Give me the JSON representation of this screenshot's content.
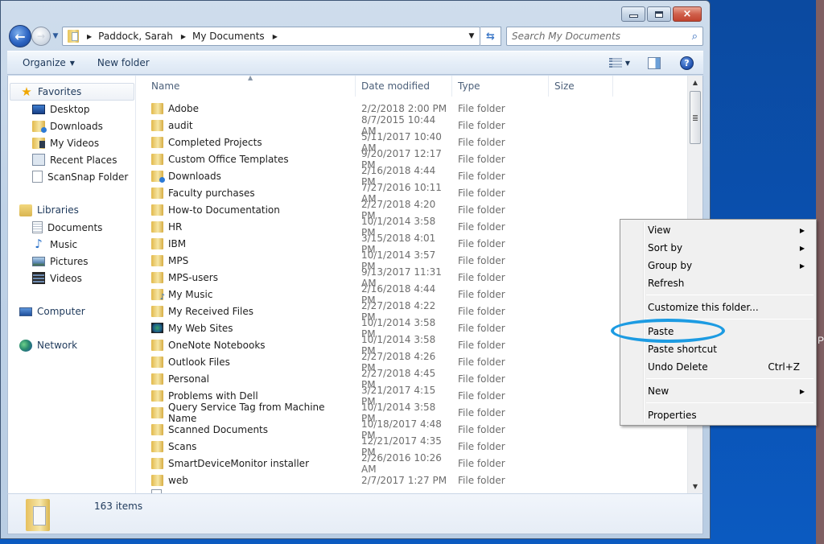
{
  "window": {
    "controls": {
      "minimize": "minimize",
      "maximize": "maximize",
      "close": "×"
    }
  },
  "address_bar": {
    "breadcrumbs": [
      "Paddock, Sarah",
      "My Documents"
    ],
    "back_icon": "arrow-left",
    "forward_icon": "arrow-right",
    "refresh_icon": "⇆"
  },
  "search": {
    "placeholder": "Search My Documents",
    "icon": "⌕"
  },
  "toolbar": {
    "organize_label": "Organize",
    "new_folder_label": "New folder",
    "help_label": "?"
  },
  "nav_pane": {
    "favorites": {
      "label": "Favorites",
      "items": [
        {
          "label": "Desktop",
          "icon": "desktop-icon"
        },
        {
          "label": "Downloads",
          "icon": "downloads-folder-icon"
        },
        {
          "label": "My Videos",
          "icon": "videos-folder-icon"
        },
        {
          "label": "Recent Places",
          "icon": "recent-places-icon"
        },
        {
          "label": "ScanSnap Folder",
          "icon": "page-icon"
        }
      ]
    },
    "libraries": {
      "label": "Libraries",
      "items": [
        {
          "label": "Documents",
          "icon": "documents-icon"
        },
        {
          "label": "Music",
          "icon": "music-icon"
        },
        {
          "label": "Pictures",
          "icon": "pictures-icon"
        },
        {
          "label": "Videos",
          "icon": "videos-icon"
        }
      ]
    },
    "computer": {
      "label": "Computer"
    },
    "network": {
      "label": "Network"
    }
  },
  "file_list": {
    "columns": [
      "Name",
      "Date modified",
      "Type",
      "Size"
    ],
    "sort_column": "Name",
    "rows": [
      {
        "name": "Adobe",
        "date": "2/2/2018 2:00 PM",
        "type": "File folder",
        "icon": "folder"
      },
      {
        "name": "audit",
        "date": "8/7/2015 10:44 AM",
        "type": "File folder",
        "icon": "folder"
      },
      {
        "name": "Completed Projects",
        "date": "5/11/2017 10:40 AM",
        "type": "File folder",
        "icon": "folder"
      },
      {
        "name": "Custom Office Templates",
        "date": "9/20/2017 12:17 PM",
        "type": "File folder",
        "icon": "folder"
      },
      {
        "name": "Downloads",
        "date": "2/16/2018 4:44 PM",
        "type": "File folder",
        "icon": "downloads-folder"
      },
      {
        "name": "Faculty purchases",
        "date": "7/27/2016 10:11 AM",
        "type": "File folder",
        "icon": "folder"
      },
      {
        "name": "How-to Documentation",
        "date": "2/27/2018 4:20 PM",
        "type": "File folder",
        "icon": "folder"
      },
      {
        "name": "HR",
        "date": "10/1/2014 3:58 PM",
        "type": "File folder",
        "icon": "folder"
      },
      {
        "name": "IBM",
        "date": "3/15/2018 4:01 PM",
        "type": "File folder",
        "icon": "folder"
      },
      {
        "name": "MPS",
        "date": "10/1/2014 3:57 PM",
        "type": "File folder",
        "icon": "folder"
      },
      {
        "name": "MPS-users",
        "date": "9/13/2017 11:31 AM",
        "type": "File folder",
        "icon": "folder"
      },
      {
        "name": "My Music",
        "date": "2/16/2018 4:44 PM",
        "type": "File folder",
        "icon": "music-folder"
      },
      {
        "name": "My Received Files",
        "date": "2/27/2018 4:22 PM",
        "type": "File folder",
        "icon": "folder"
      },
      {
        "name": "My Web Sites",
        "date": "10/1/2014 3:58 PM",
        "type": "File folder",
        "icon": "web-sites"
      },
      {
        "name": "OneNote Notebooks",
        "date": "10/1/2014 3:58 PM",
        "type": "File folder",
        "icon": "folder"
      },
      {
        "name": "Outlook Files",
        "date": "2/27/2018 4:26 PM",
        "type": "File folder",
        "icon": "folder"
      },
      {
        "name": "Personal",
        "date": "2/27/2018 4:45 PM",
        "type": "File folder",
        "icon": "folder"
      },
      {
        "name": "Problems with Dell",
        "date": "3/21/2017 4:15 PM",
        "type": "File folder",
        "icon": "folder"
      },
      {
        "name": "Query Service Tag from Machine Name",
        "date": "10/1/2014 3:58 PM",
        "type": "File folder",
        "icon": "folder"
      },
      {
        "name": "Scanned Documents",
        "date": "10/18/2017 4:48 PM",
        "type": "File folder",
        "icon": "folder"
      },
      {
        "name": "Scans",
        "date": "12/21/2017 4:35 PM",
        "type": "File folder",
        "icon": "folder"
      },
      {
        "name": "SmartDeviceMonitor installer",
        "date": "2/26/2016 10:26 AM",
        "type": "File folder",
        "icon": "folder"
      },
      {
        "name": "web",
        "date": "2/7/2017 1:27 PM",
        "type": "File folder",
        "icon": "folder"
      }
    ]
  },
  "status": {
    "item_count": "163 items"
  },
  "context_menu": {
    "items": [
      {
        "label": "View",
        "submenu": true
      },
      {
        "label": "Sort by",
        "submenu": true
      },
      {
        "label": "Group by",
        "submenu": true
      },
      {
        "label": "Refresh"
      },
      {
        "separator": true
      },
      {
        "label": "Customize this folder..."
      },
      {
        "separator": true
      },
      {
        "label": "Paste",
        "highlighted": true
      },
      {
        "label": "Paste shortcut"
      },
      {
        "label": "Undo Delete",
        "accelerator": "Ctrl+Z"
      },
      {
        "separator": true
      },
      {
        "label": "New",
        "submenu": true
      },
      {
        "separator": true
      },
      {
        "label": "Properties"
      }
    ]
  },
  "desktop": {
    "partial_label": "P"
  },
  "colors": {
    "highlight_ellipse": "#1c9be2",
    "desktop_bg": "#0b4aa0",
    "close_button": "#c2432e"
  }
}
